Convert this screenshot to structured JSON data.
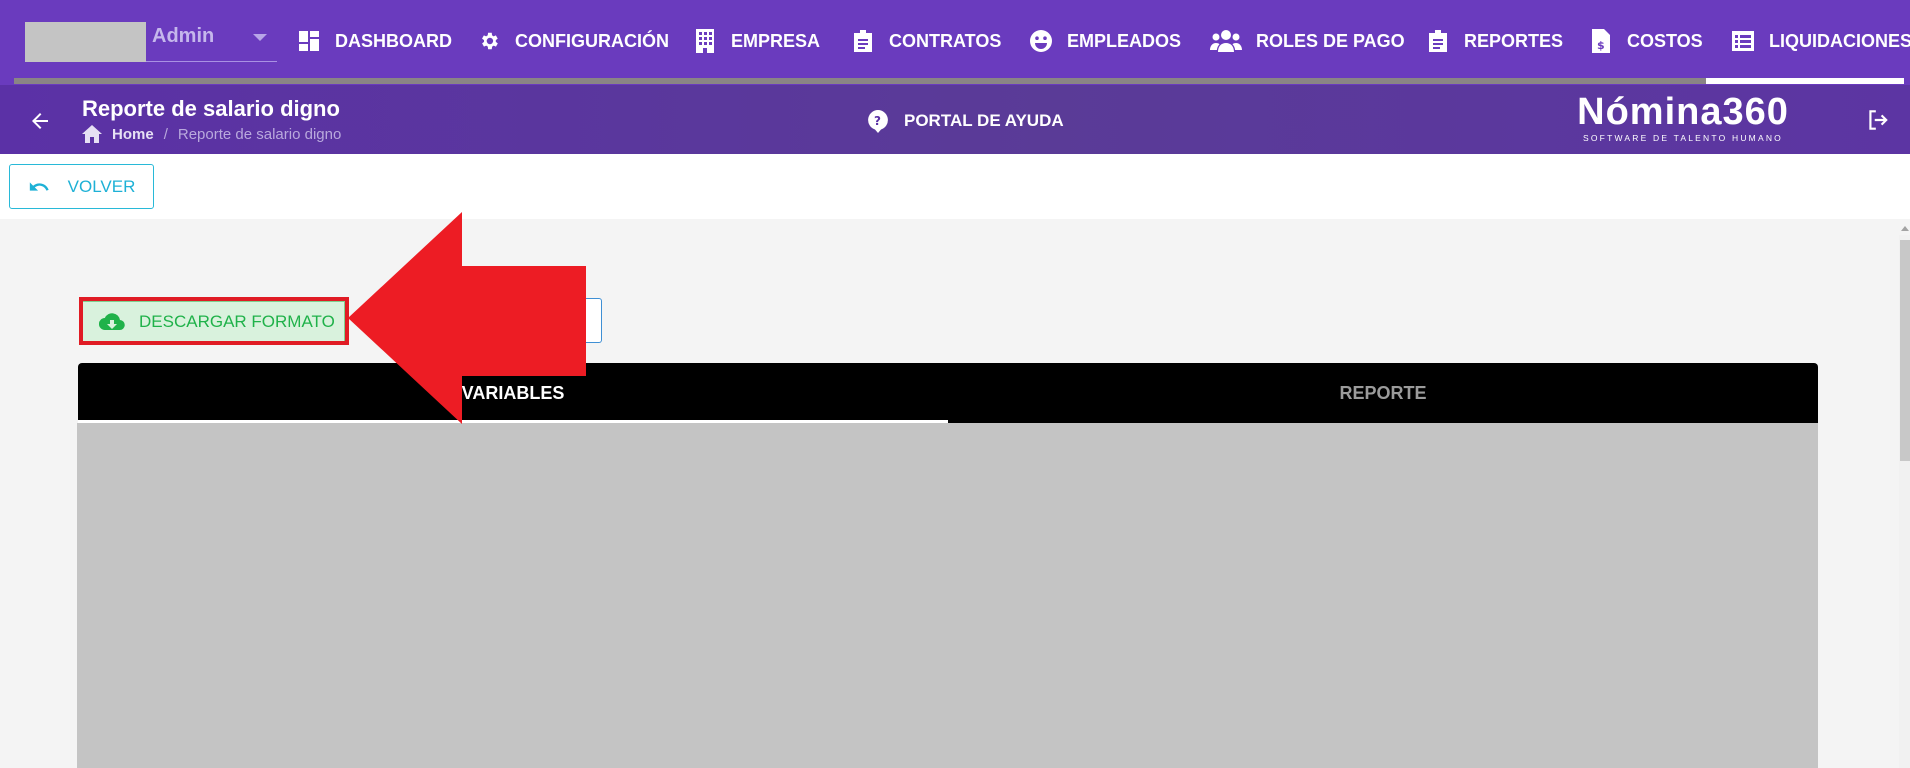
{
  "user": {
    "name": "Admin"
  },
  "nav": {
    "items": [
      {
        "label": "DASHBOARD",
        "icon": "dashboard-icon"
      },
      {
        "label": "CONFIGURACIÓN",
        "icon": "gear-icon"
      },
      {
        "label": "EMPRESA",
        "icon": "building-icon"
      },
      {
        "label": "CONTRATOS",
        "icon": "clipboard-icon"
      },
      {
        "label": "EMPLEADOS",
        "icon": "face-icon"
      },
      {
        "label": "ROLES DE PAGO",
        "icon": "users-icon"
      },
      {
        "label": "REPORTES",
        "icon": "clipboard-icon"
      },
      {
        "label": "COSTOS",
        "icon": "invoice-dollar-icon"
      },
      {
        "label": "LIQUIDACIONES",
        "icon": "list-icon"
      }
    ]
  },
  "header": {
    "title": "Reporte de salario digno",
    "breadcrumb": {
      "home": "Home",
      "separator": "/",
      "current": "Reporte de salario digno"
    },
    "help_label": "PORTAL DE AYUDA",
    "logo": {
      "main": "Nómina360",
      "tagline": "SOFTWARE DE TALENTO HUMANO"
    }
  },
  "toolbar": {
    "back_label": "VOLVER"
  },
  "actions": {
    "download_label": "DESCARGAR FORMATO"
  },
  "tabs": [
    {
      "label": "VARIABLES",
      "active": true
    },
    {
      "label": "REPORTE",
      "active": false
    }
  ],
  "colors": {
    "nav_bg": "#6a3bbe",
    "header_bg": "#5b31a6",
    "accent_cyan": "#1eb1d6",
    "success_green": "#20b24a",
    "annotation_red": "#e01b24"
  }
}
